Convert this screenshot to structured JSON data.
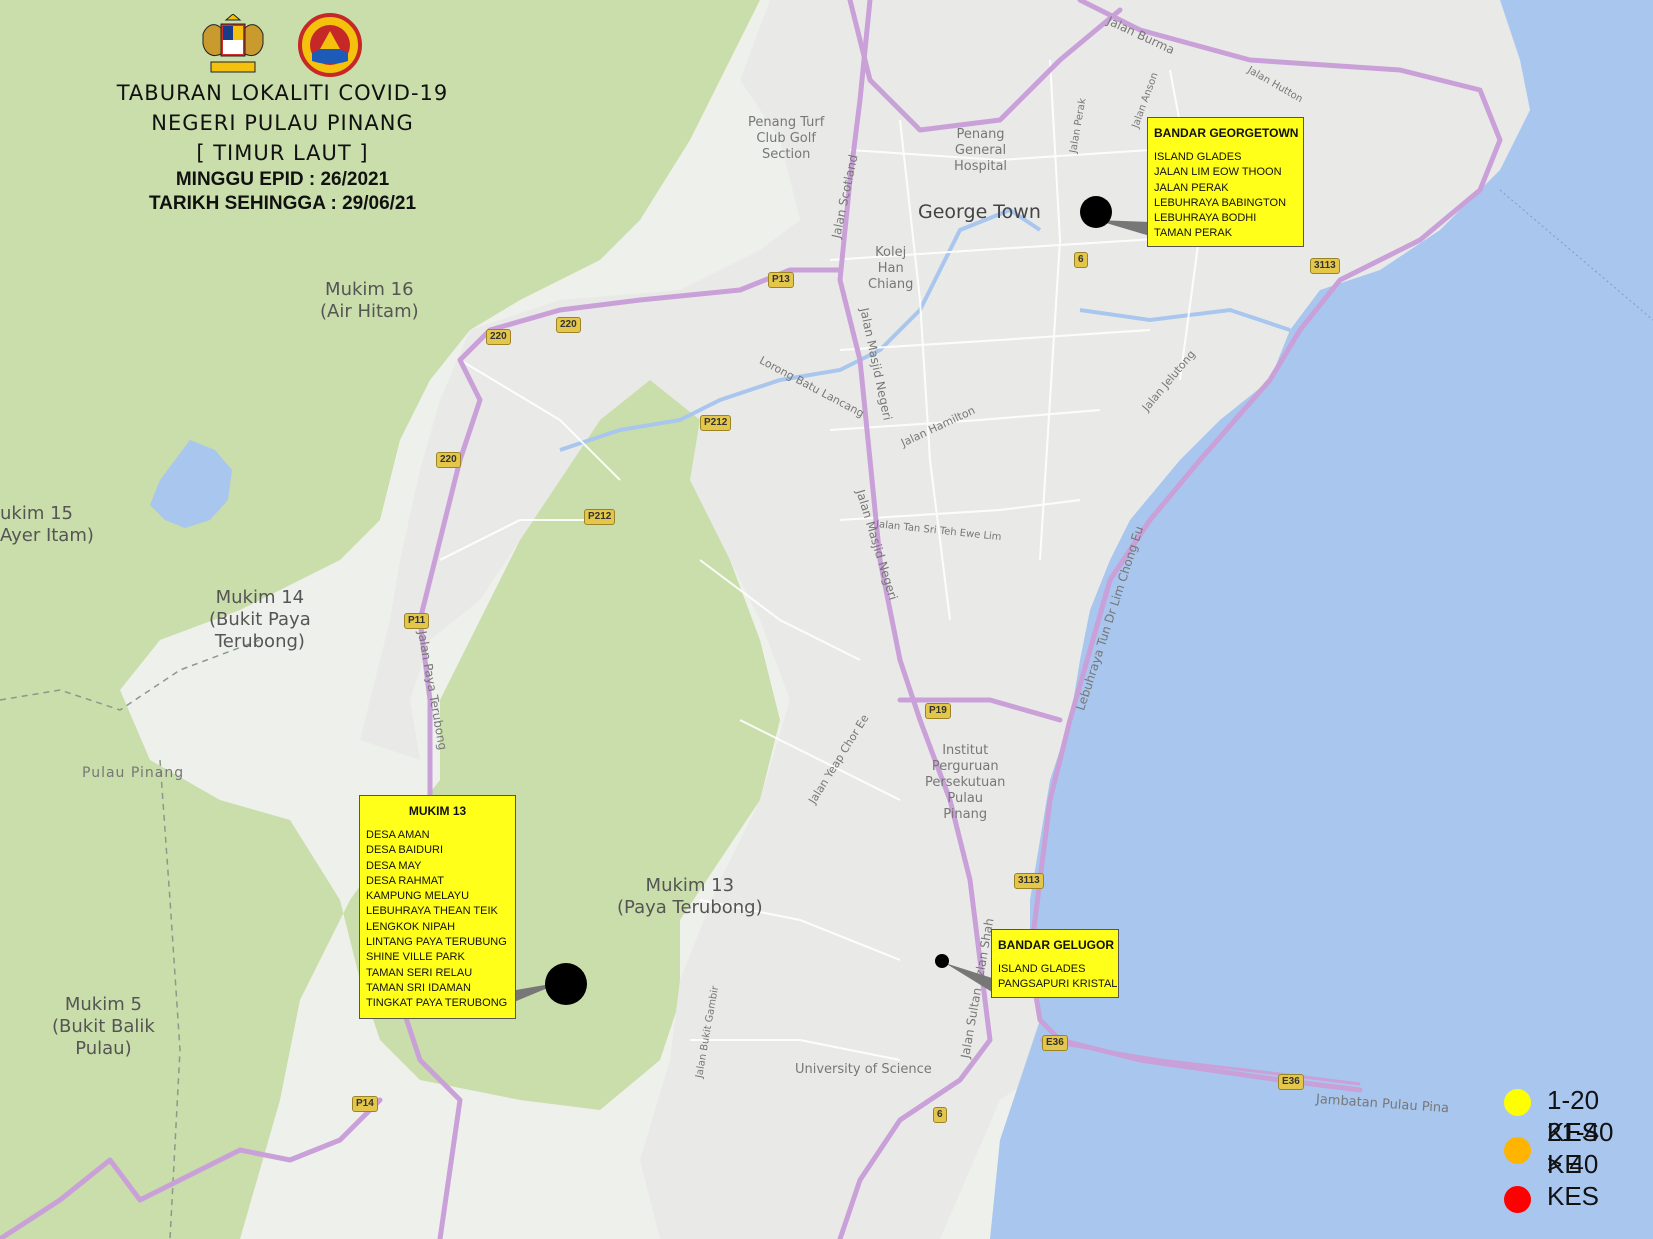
{
  "header": {
    "title_lines": [
      "TABURAN LOKALITI COVID-19",
      "NEGERI PULAU PINANG",
      "[ TIMUR LAUT ]"
    ],
    "epid": "MINGGU EPID : 26/2021",
    "date": "TARIKH SEHINGGA : 29/06/21"
  },
  "logos": [
    "coat-of-arms-icon",
    "state-seal-icon"
  ],
  "map_labels": {
    "george_town": "George Town",
    "mukim16_a": "Mukim 16",
    "mukim16_b": "(Air Hitam)",
    "mukim15_a": "ukim 15",
    "mukim15_b": "Ayer Itam)",
    "mukim14_a": "Mukim 14",
    "mukim14_b": "(Bukit Paya",
    "mukim14_c": "Terubong)",
    "mukim13_a": "Mukim 13",
    "mukim13_b": "(Paya Terubong)",
    "mukim5_a": "Mukim 5",
    "mukim5_b": "(Bukit Balik",
    "mukim5_c": "Pulau)",
    "pulau_pinang": "Pulau Pinang",
    "turf_a": "Penang Turf",
    "turf_b": "Club Golf",
    "turf_c": "Section",
    "hospital_a": "Penang",
    "hospital_b": "General",
    "hospital_c": "Hospital",
    "kolej_a": "Kolej",
    "kolej_b": "Han",
    "kolej_c": "Chiang",
    "institut_a": "Institut",
    "institut_b": "Perguruan",
    "institut_c": "Persekutuan",
    "institut_d": "Pulau",
    "institut_e": "Pinang",
    "usm": "University of Science",
    "jambatan": "Jambatan Pulau Pina",
    "jalan_burma": "Jalan Burma",
    "jalan_scotland": "Jalan Scotland",
    "jalan_masjid_negeri": "Jalan Masjid Negeri",
    "jalan_paya_terubong": "Jalan Paya Terubong",
    "jalan_sultan_azlan_shah": "Jalan Sultan Azlan Shah",
    "lebuhraya_tun_dr_lim": "Lebuhraya Tun Dr Lim Chong Eu",
    "lorong_batu_lancang": "Lorong Batu Lancang",
    "jalan_hamilton": "Jalan Hamilton",
    "jalan_jelutong": "Jalan Jelutong",
    "jalan_tan_sri_teh": "Jalan Tan Sri Teh Ewe Lim",
    "jalan_yeap_chor_ee": "Jalan Yeap Chor Ee",
    "jalan_bukit_gambir": "Jalan Bukit Gambir",
    "jalan_perak": "Jalan Perak",
    "jalan_anson": "Jalan Anson",
    "jalan_hutton": "Jalan Hutton"
  },
  "road_shields": [
    {
      "id": "s1",
      "label": "P13"
    },
    {
      "id": "s2",
      "label": "220"
    },
    {
      "id": "s3",
      "label": "220"
    },
    {
      "id": "s4",
      "label": "220"
    },
    {
      "id": "s5",
      "label": "P212"
    },
    {
      "id": "s6",
      "label": "P212"
    },
    {
      "id": "s7",
      "label": "P11"
    },
    {
      "id": "s8",
      "label": "P19"
    },
    {
      "id": "s9",
      "label": "6"
    },
    {
      "id": "s10",
      "label": "3113"
    },
    {
      "id": "s11",
      "label": "3113"
    },
    {
      "id": "s12",
      "label": "E36"
    },
    {
      "id": "s13",
      "label": "E36"
    },
    {
      "id": "s14",
      "label": "6"
    },
    {
      "id": "s15",
      "label": "P14"
    }
  ],
  "boxes": {
    "georgetown": {
      "title": "BANDAR GEORGETOWN",
      "items": [
        "ISLAND GLADES",
        "JALAN LIM EOW THOON",
        "JALAN PERAK",
        "LEBUHRAYA BABINGTON",
        "LEBUHRAYA BODHI",
        "TAMAN PERAK"
      ]
    },
    "mukim13": {
      "title": "MUKIM 13",
      "items": [
        "DESA AMAN",
        "DESA BAIDURI",
        "DESA MAY",
        "DESA RAHMAT",
        "KAMPUNG MELAYU",
        "LEBUHRAYA THEAN TEIK",
        "LENGKOK NIPAH",
        "LINTANG PAYA TERUBUNG",
        "SHINE VILLE PARK",
        "TAMAN SERI RELAU",
        "TAMAN SRI IDAMAN",
        "TINGKAT PAYA TERUBONG"
      ]
    },
    "gelugor": {
      "title": "BANDAR GELUGOR",
      "items": [
        "ISLAND GLADES",
        "PANGSAPURI KRISTAL"
      ]
    }
  },
  "legend": [
    {
      "label": "1-20 KES",
      "color": "#ffff00"
    },
    {
      "label": "21-40 KE",
      "color": "#ffb400"
    },
    {
      "label": "> 40 KES",
      "color": "#ff0000"
    }
  ],
  "colors": {
    "sea": "#a9c6ee",
    "forest": "#c9deaa",
    "urban": "#ebebeb",
    "highway": "#d2a8de",
    "callout": "#ffff1a",
    "marker": "#000000"
  }
}
